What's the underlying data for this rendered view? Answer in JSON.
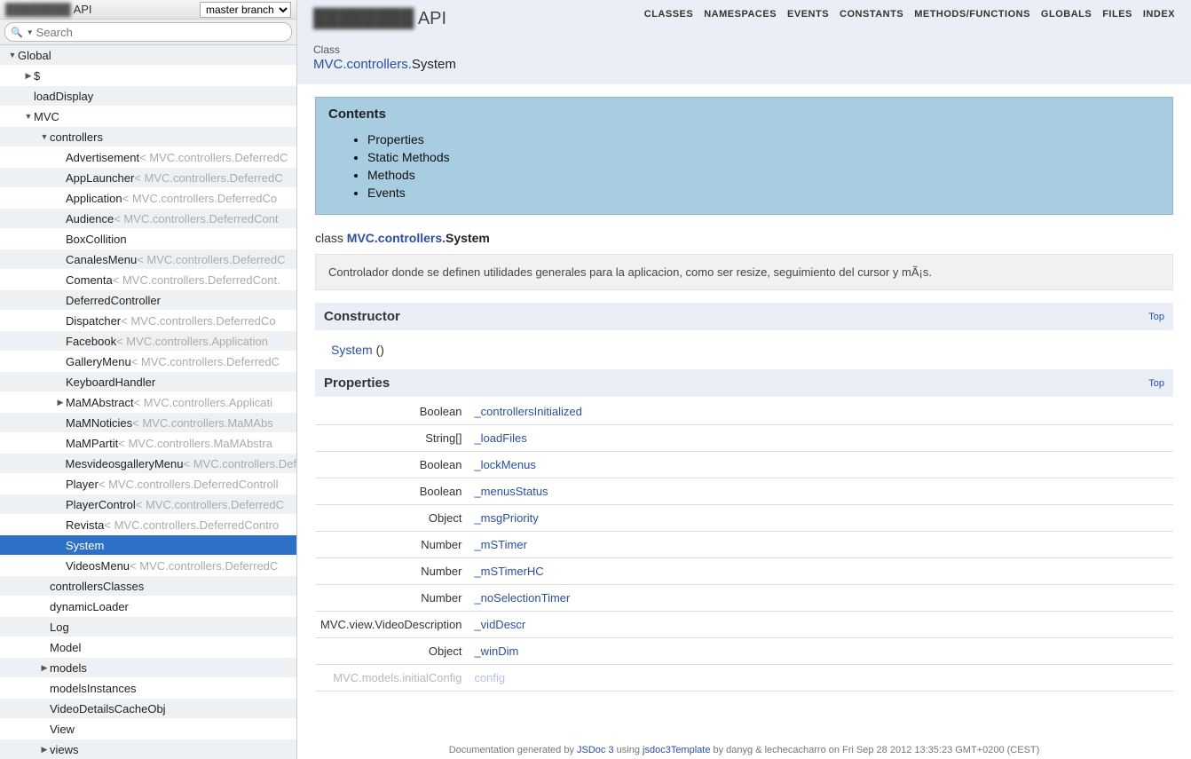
{
  "sidebar": {
    "title_blur": "████████",
    "title_api": " API",
    "branch": "master branch",
    "search_placeholder": "Search"
  },
  "tree": [
    {
      "indent": 0,
      "arrow": "▼",
      "label": "Global"
    },
    {
      "indent": 1,
      "arrow": "▶",
      "label": "$"
    },
    {
      "indent": 1,
      "arrow": "",
      "label": "loadDisplay"
    },
    {
      "indent": 1,
      "arrow": "▼",
      "label": "MVC"
    },
    {
      "indent": 2,
      "arrow": "▼",
      "label": "controllers"
    },
    {
      "indent": 3,
      "arrow": "",
      "label": "Advertisement",
      "inherit": " < MVC.controllers.DeferredC"
    },
    {
      "indent": 3,
      "arrow": "",
      "label": "AppLauncher",
      "inherit": " < MVC.controllers.DeferredC"
    },
    {
      "indent": 3,
      "arrow": "",
      "label": "Application",
      "inherit": " < MVC.controllers.DeferredCo"
    },
    {
      "indent": 3,
      "arrow": "",
      "label": "Audience",
      "inherit": " < MVC.controllers.DeferredCont"
    },
    {
      "indent": 3,
      "arrow": "",
      "label": "BoxCollition"
    },
    {
      "indent": 3,
      "arrow": "",
      "label": "CanalesMenu",
      "inherit": " < MVC.controllers.DeferredC"
    },
    {
      "indent": 3,
      "arrow": "",
      "label": "Comenta",
      "inherit": " < MVC.controllers.DeferredCont."
    },
    {
      "indent": 3,
      "arrow": "",
      "label": "DeferredController"
    },
    {
      "indent": 3,
      "arrow": "",
      "label": "Dispatcher",
      "inherit": " < MVC.controllers.DeferredCo"
    },
    {
      "indent": 3,
      "arrow": "",
      "label": "Facebook",
      "inherit": " < MVC.controllers.Application"
    },
    {
      "indent": 3,
      "arrow": "",
      "label": "GalleryMenu",
      "inherit": " < MVC.controllers.DeferredC"
    },
    {
      "indent": 3,
      "arrow": "",
      "label": "KeyboardHandler"
    },
    {
      "indent": 3,
      "arrow": "▶",
      "label": "MaMAbstract",
      "inherit": " < MVC.controllers.Applicati"
    },
    {
      "indent": 3,
      "arrow": "",
      "label": "MaMNoticies",
      "inherit": " < MVC.controllers.MaMAbs"
    },
    {
      "indent": 3,
      "arrow": "",
      "label": "MaMPartit",
      "inherit": " < MVC.controllers.MaMAbstra"
    },
    {
      "indent": 3,
      "arrow": "",
      "label": "MesvideosgalleryMenu",
      "inherit": " < MVC.controllers.Def"
    },
    {
      "indent": 3,
      "arrow": "",
      "label": "Player",
      "inherit": " < MVC.controllers.DeferredControll"
    },
    {
      "indent": 3,
      "arrow": "",
      "label": "PlayerControl",
      "inherit": " < MVC.controllers.DeferredC"
    },
    {
      "indent": 3,
      "arrow": "",
      "label": "Revista",
      "inherit": " < MVC.controllers.DeferredContro"
    },
    {
      "indent": 3,
      "arrow": "",
      "label": "System",
      "selected": true
    },
    {
      "indent": 3,
      "arrow": "",
      "label": "VideosMenu",
      "inherit": " < MVC.controllers.DeferredC"
    },
    {
      "indent": 2,
      "arrow": "",
      "label": "controllersClasses"
    },
    {
      "indent": 2,
      "arrow": "",
      "label": "dynamicLoader"
    },
    {
      "indent": 2,
      "arrow": "",
      "label": "Log"
    },
    {
      "indent": 2,
      "arrow": "",
      "label": "Model"
    },
    {
      "indent": 2,
      "arrow": "▶",
      "label": "models"
    },
    {
      "indent": 2,
      "arrow": "",
      "label": "modelsInstances"
    },
    {
      "indent": 2,
      "arrow": "",
      "label": "VideoDetailsCacheObj"
    },
    {
      "indent": 2,
      "arrow": "",
      "label": "View"
    },
    {
      "indent": 2,
      "arrow": "▶",
      "label": "views"
    }
  ],
  "topnav": [
    "CLASSES",
    "NAMESPACES",
    "EVENTS",
    "CONSTANTS",
    "METHODS/FUNCTIONS",
    "GLOBALS",
    "FILES",
    "INDEX"
  ],
  "header": {
    "brand_blur": "████████",
    "brand_api": " API",
    "class_label": "Class",
    "ns": "MVC.controllers.",
    "cls": "System"
  },
  "contents": {
    "title": "Contents",
    "items": [
      "Properties",
      "Static Methods",
      "Methods",
      "Events"
    ]
  },
  "classline": {
    "prefix": "class ",
    "ns": "MVC.controllers.",
    "cls": "System"
  },
  "description": "Controlador donde se definen utilidades generales para la aplicacion, como ser resize, seguimiento del cursor y mÃ¡s.",
  "sections": {
    "constructor": "Constructor",
    "properties": "Properties",
    "top": "Top"
  },
  "constructor_fn": "System",
  "constructor_args": " ()",
  "properties": [
    {
      "type": "Boolean",
      "name": "_controllersInitialized"
    },
    {
      "type": "String[]",
      "name": "_loadFiles"
    },
    {
      "type": "Boolean",
      "name": "_lockMenus"
    },
    {
      "type": "Boolean",
      "name": "_menusStatus"
    },
    {
      "type": "Object",
      "name": "_msgPriority"
    },
    {
      "type": "Number",
      "name": "_mSTimer"
    },
    {
      "type": "Number",
      "name": "_mSTimerHC"
    },
    {
      "type": "Number",
      "name": "_noSelectionTimer"
    },
    {
      "type": "MVC.view.VideoDescription",
      "name": "_vidDescr"
    },
    {
      "type": "Object",
      "name": "_winDim"
    }
  ],
  "cut_row": {
    "type": "MVC.models.initialConfig",
    "name": "config"
  },
  "footer": {
    "p1": "Documentation generated by ",
    "a1": "JSDoc 3",
    "p2": " using ",
    "a2": "jsdoc3Template",
    "p3": " by danyg & lechecacharro on Fri Sep 28 2012 13:35:23 GMT+0200 (CEST)"
  }
}
